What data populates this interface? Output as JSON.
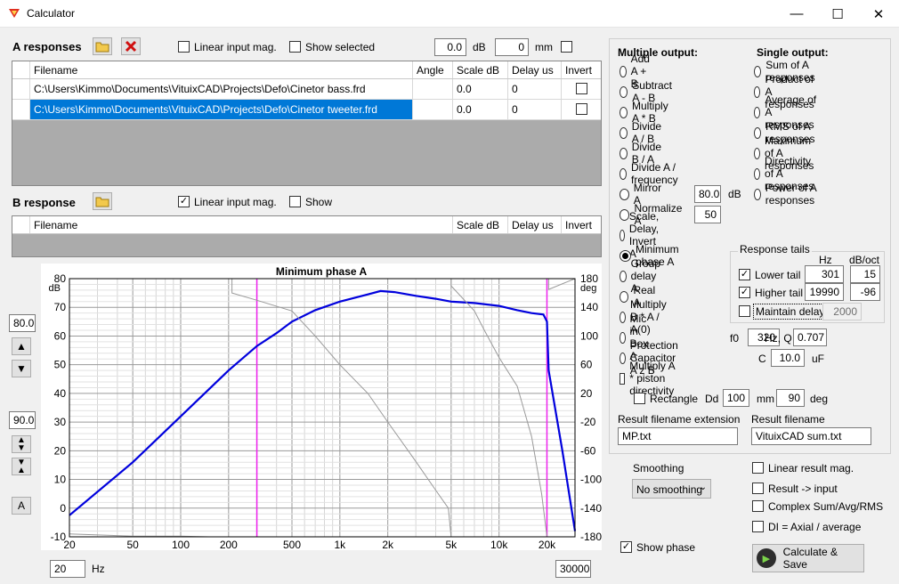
{
  "window": {
    "title": "Calculator",
    "minimize": "—",
    "maximize": "☐",
    "close": "✕"
  },
  "a_responses": {
    "label": "A responses",
    "linear_input_mag_label": "Linear input mag.",
    "linear_input_mag": false,
    "show_selected_label": "Show selected",
    "show_selected": false,
    "db_value": "0.0",
    "db_unit": "dB",
    "mm_value": "0",
    "mm_unit": "mm",
    "columns": [
      "Filename",
      "Angle",
      "Scale dB",
      "Delay us",
      "Invert"
    ],
    "rows": [
      {
        "filename": "C:\\Users\\Kimmo\\Documents\\VituixCAD\\Projects\\Defo\\Cinetor bass.frd",
        "angle": "",
        "scale": "0.0",
        "delay": "0",
        "invert": false
      },
      {
        "filename": "C:\\Users\\Kimmo\\Documents\\VituixCAD\\Projects\\Defo\\Cinetor tweeter.frd",
        "angle": "",
        "scale": "0.0",
        "delay": "0",
        "invert": false
      }
    ]
  },
  "b_response": {
    "label": "B response",
    "linear_input_mag_label": "Linear input mag.",
    "linear_input_mag": true,
    "show_label": "Show",
    "show": false,
    "columns": [
      "Filename",
      "Scale dB",
      "Delay us",
      "Invert"
    ]
  },
  "left_controls": {
    "top_value": "80.0",
    "range_value": "90.0",
    "auto_label": "A"
  },
  "x_range": {
    "min": "20",
    "unit": "Hz",
    "max": "30000"
  },
  "chart_data": {
    "type": "line",
    "title": "Minimum phase A",
    "xlabel": "",
    "ylabel": "dB",
    "y2label": "deg",
    "x_scale": "log",
    "xlim": [
      20,
      30000
    ],
    "ylim": [
      -10,
      80
    ],
    "y2lim": [
      -180,
      180
    ],
    "x_ticks": [
      "20",
      "50",
      "100",
      "200",
      "500",
      "1k",
      "2k",
      "5k",
      "10k",
      "20k"
    ],
    "x_tick_values": [
      20,
      50,
      100,
      200,
      500,
      1000,
      2000,
      5000,
      10000,
      20000
    ],
    "y_ticks": [
      "-10",
      "0",
      "10",
      "20",
      "30",
      "40",
      "50",
      "60",
      "70",
      "80"
    ],
    "y_tick_values": [
      -10,
      0,
      10,
      20,
      30,
      40,
      50,
      60,
      70,
      80
    ],
    "y2_ticks": [
      "-180",
      "-140",
      "-100",
      "-60",
      "-20",
      "20",
      "60",
      "100",
      "140",
      "180"
    ],
    "y2_tick_values": [
      -180,
      -140,
      -100,
      -60,
      -20,
      20,
      60,
      100,
      140,
      180
    ],
    "markers_hz": [
      301,
      19990
    ],
    "grid": true,
    "series": [
      {
        "color": "#0000dd",
        "axis": "y",
        "points": [
          [
            20,
            -2.5
          ],
          [
            50,
            16
          ],
          [
            100,
            32
          ],
          [
            200,
            48
          ],
          [
            301,
            56.5
          ],
          [
            400,
            61
          ],
          [
            500,
            65
          ],
          [
            700,
            69
          ],
          [
            1000,
            72
          ],
          [
            1500,
            74.5
          ],
          [
            1800,
            75.7
          ],
          [
            2200,
            75.3
          ],
          [
            3000,
            74
          ],
          [
            4000,
            73
          ],
          [
            5000,
            72
          ],
          [
            7000,
            71.5
          ],
          [
            10000,
            70.5
          ],
          [
            13000,
            69
          ],
          [
            16000,
            68
          ],
          [
            19000,
            67.5
          ],
          [
            19990,
            65
          ],
          [
            20500,
            48
          ],
          [
            25000,
            20
          ],
          [
            30000,
            -8
          ]
        ]
      },
      {
        "color": "#999999",
        "axis": "y2",
        "points": [
          [
            20,
            -176
          ],
          [
            50,
            -179
          ],
          [
            100,
            -179
          ],
          [
            150,
            -180
          ],
          [
            200,
            -180
          ],
          [
            210,
            160
          ],
          [
            300,
            150
          ],
          [
            500,
            135
          ],
          [
            700,
            100
          ],
          [
            1000,
            60
          ],
          [
            1500,
            20
          ],
          [
            2000,
            -20
          ],
          [
            3000,
            -75
          ],
          [
            4000,
            -115
          ],
          [
            4800,
            -140
          ],
          [
            5000,
            170
          ],
          [
            7000,
            135
          ],
          [
            8000,
            110
          ],
          [
            10000,
            70
          ],
          [
            13000,
            30
          ],
          [
            16000,
            -40
          ],
          [
            18500,
            -120
          ],
          [
            19990,
            -180
          ],
          [
            20500,
            165
          ],
          [
            30000,
            -140
          ]
        ]
      }
    ]
  },
  "calc": {
    "multiple_output_label": "Multiple output:",
    "single_output_label": "Single output:",
    "multiple_options": [
      "Add A + B",
      "Subtract A - B",
      "Multiply A * B",
      "Divide A / B",
      "Divide B / A",
      "Divide A / frequency",
      "Mirror A",
      "Normalize A",
      "Scale, Delay, Invert A",
      "Minimum phase A",
      "Group delay A",
      "Real A",
      "Multiply B * A / A(0)",
      "Mic in Box A",
      "Protection Capacitor A z B",
      "Multiply A * piston directivity"
    ],
    "selected_option": "Minimum phase A",
    "single_options": [
      "Sum of A responses",
      "Product of A responses",
      "Average of A responses",
      "RMS of A responses",
      "Maximum of A responses",
      "Directivity of A responses",
      "Power of A responses"
    ],
    "mirror_value": "80.0",
    "mirror_unit": "dB",
    "normalize_value": "50",
    "response_tails": {
      "label": "Response tails",
      "hz_header": "Hz",
      "dboct_header": "dB/oct",
      "lower_label": "Lower tail",
      "lower_checked": true,
      "lower_hz": "301",
      "lower_slope": "15",
      "higher_label": "Higher tail",
      "higher_checked": true,
      "higher_hz": "19990",
      "higher_slope": "-96",
      "maintain_label": "Maintain delay",
      "maintain_checked": false,
      "maintain_value": "2000"
    },
    "mic_f0_label": "f0",
    "mic_f0": "320",
    "mic_hzq_label": "Hz, Q",
    "mic_q": "0.707",
    "cap_label": "C",
    "cap_value": "10.0",
    "cap_unit": "uF",
    "rectangle_label": "Rectangle",
    "rectangle_checked": false,
    "dd_label": "Dd",
    "dd_value": "100",
    "dd_unit": "mm",
    "deg_value": "90",
    "deg_unit": "deg",
    "result_ext_label": "Result filename extension",
    "result_ext": "MP.txt",
    "result_file_label": "Result filename",
    "result_file": "VituixCAD sum.txt"
  },
  "bottom": {
    "smoothing_label": "Smoothing",
    "smoothing_value": "No smoothing",
    "show_phase_label": "Show phase",
    "show_phase": true,
    "linear_result_label": "Linear result mag.",
    "result_input_label": "Result -> input",
    "complex_label": "Complex Sum/Avg/RMS",
    "di_label": "DI = Axial / average",
    "calculate_label": "Calculate & Save"
  }
}
